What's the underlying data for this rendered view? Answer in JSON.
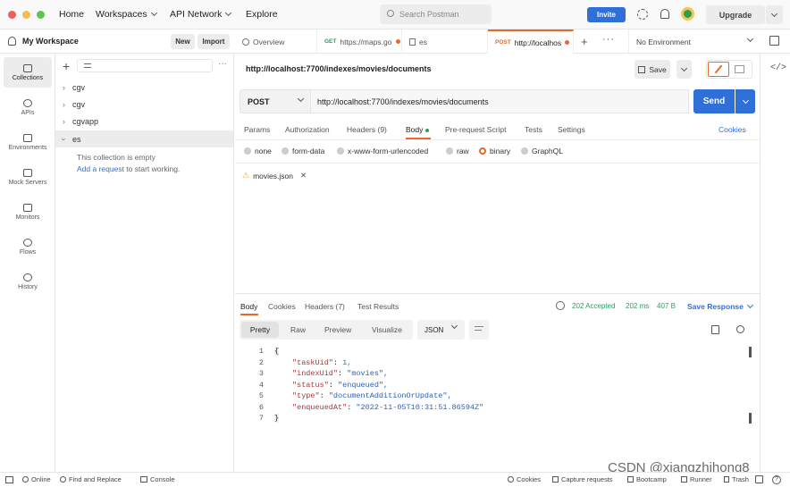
{
  "topbar": {
    "nav": [
      "Home",
      "Workspaces",
      "API Network",
      "Explore"
    ],
    "search_placeholder": "Search Postman",
    "invite": "Invite",
    "upgrade": "Upgrade"
  },
  "workspace": {
    "name": "My Workspace",
    "new_label": "New",
    "import_label": "Import"
  },
  "tabs": [
    {
      "label": "Overview"
    },
    {
      "method": "GET",
      "label": "https://maps.go"
    },
    {
      "label": "es"
    },
    {
      "method": "POST",
      "label": "http://localhos"
    }
  ],
  "environment": "No Environment",
  "rail": [
    "Collections",
    "APIs",
    "Environments",
    "Mock Servers",
    "Monitors",
    "Flows",
    "History"
  ],
  "sidebar": {
    "collections": [
      "cgv",
      "cgv",
      "cgvapp",
      "es"
    ],
    "empty_text": "This collection is empty",
    "add_request": "Add a request",
    "add_request_suffix": " to start working."
  },
  "request": {
    "title": "http://localhost:7700/indexes/movies/documents",
    "save": "Save",
    "method": "POST",
    "url": "http://localhost:7700/indexes/movies/documents",
    "send": "Send",
    "tabs": [
      "Params",
      "Authorization",
      "Headers (9)",
      "Body",
      "Pre-request Script",
      "Tests",
      "Settings"
    ],
    "cookies": "Cookies",
    "body_types": [
      "none",
      "form-data",
      "x-www-form-urlencoded",
      "raw",
      "binary",
      "GraphQL"
    ],
    "file": "movies.json"
  },
  "response": {
    "tabs": [
      "Body",
      "Cookies",
      "Headers (7)",
      "Test Results"
    ],
    "status": "202 Accepted",
    "time": "202 ms",
    "size": "407 B",
    "save_response": "Save Response",
    "views": [
      "Pretty",
      "Raw",
      "Preview",
      "Visualize"
    ],
    "format": "JSON",
    "lines": [
      {
        "n": "1",
        "text": "{"
      },
      {
        "n": "2",
        "key": "\"taskUid\"",
        "val": " 1,",
        "type": "num"
      },
      {
        "n": "3",
        "key": "\"indexUid\"",
        "val": " \"movies\",",
        "type": "str"
      },
      {
        "n": "4",
        "key": "\"status\"",
        "val": " \"enqueued\",",
        "type": "str"
      },
      {
        "n": "5",
        "key": "\"type\"",
        "val": " \"documentAdditionOrUpdate\",",
        "type": "str"
      },
      {
        "n": "6",
        "key": "\"enqueuedAt\"",
        "val": " \"2022-11-05T10:31:51.86594Z\"",
        "type": "str"
      },
      {
        "n": "7",
        "text": "}"
      }
    ]
  },
  "statusbar": {
    "online": "Online",
    "find_replace": "Find and Replace",
    "console": "Console",
    "cookies": "Cookies",
    "capture": "Capture requests",
    "bootcamp": "Bootcamp",
    "runner": "Runner",
    "trash": "Trash"
  },
  "watermark": "CSDN @xiangzhihong8",
  "colors": {
    "accent": "#2e6fd8",
    "orange": "#e6692d",
    "green": "#2a9d5c"
  }
}
